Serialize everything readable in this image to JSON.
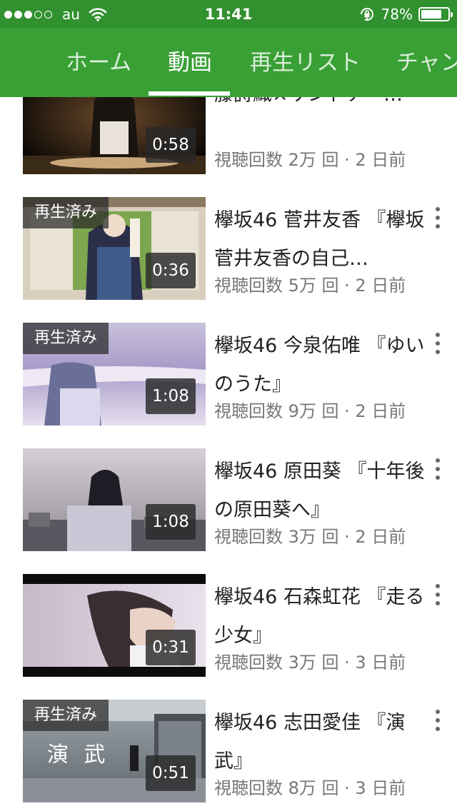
{
  "status": {
    "carrier": "au",
    "time": "11:41",
    "battery": "78%",
    "signal_dots_filled": 3,
    "signal_dots_total": 5,
    "icons": [
      "wifi-icon",
      "rotation-lock-icon",
      "battery-icon"
    ]
  },
  "tabs": [
    {
      "label": "ホーム",
      "active": false
    },
    {
      "label": "動画",
      "active": true
    },
    {
      "label": "再生リスト",
      "active": false
    },
    {
      "label": "チャンネル",
      "active": false
    }
  ],
  "colors": {
    "status_bar": "#31912f",
    "tab_bar": "#39a035"
  },
  "videos": [
    {
      "title": "藤詩織×サンドアー…",
      "views": "視聴回数 2万 回 · 2 日前",
      "duration": "0:58",
      "watched": ""
    },
    {
      "title": "欅坂46 菅井友香 『欅坂 菅井友香の自己…",
      "views": "視聴回数 5万 回 · 2 日前",
      "duration": "0:36",
      "watched": "再生済み"
    },
    {
      "title": "欅坂46 今泉佑唯 『ゆいのうた』",
      "views": "視聴回数 9万 回 · 2 日前",
      "duration": "1:08",
      "watched": "再生済み"
    },
    {
      "title": "欅坂46 原田葵 『十年後の原田葵へ』",
      "views": "視聴回数 3万 回 · 2 日前",
      "duration": "1:08",
      "watched": ""
    },
    {
      "title": "欅坂46 石森虹花 『走る少女』",
      "views": "視聴回数 3万 回 · 3 日前",
      "duration": "0:31",
      "watched": ""
    },
    {
      "title": "欅坂46 志田愛佳 『演武』",
      "views": "視聴回数 8万 回 · 3 日前",
      "duration": "0:51",
      "watched": "再生済み",
      "thumb_text": "演 武"
    }
  ]
}
